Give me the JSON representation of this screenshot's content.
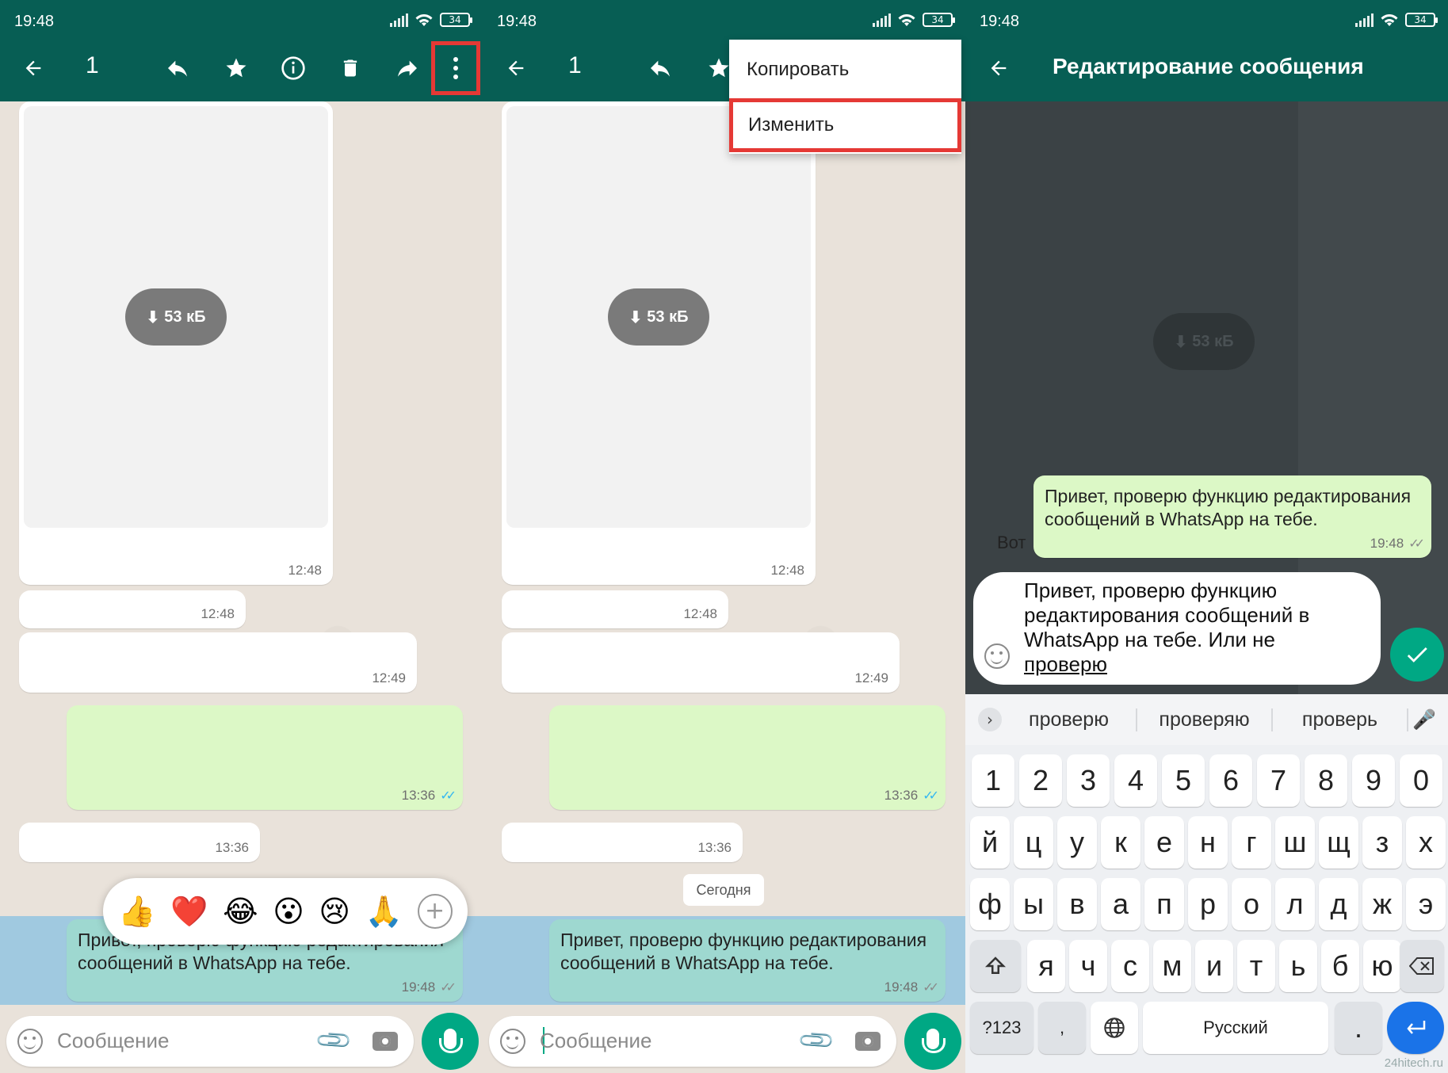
{
  "status": {
    "time": "19:48",
    "battery": "34"
  },
  "panel1": {
    "toolbar": {
      "count": "1",
      "back": "back-arrow",
      "reply": "reply",
      "star": "star",
      "info": "info",
      "delete": "delete",
      "forward": "forward",
      "more": "more"
    },
    "messages": [
      {
        "time": "12:48",
        "size": "53 кБ"
      },
      {
        "time": "12:48"
      },
      {
        "time": "12:49"
      },
      {
        "time": "13:36"
      },
      {
        "time": "13:36"
      }
    ],
    "reactions": [
      "👍",
      "❤️",
      "😂",
      "😮",
      "😢",
      "🙏"
    ],
    "selected_message": {
      "text_visible_tail": "Прив",
      "text": "Привет, проверю функцию редактирования сообщений в WhatsApp на тебе.",
      "time": "19:48"
    },
    "input": {
      "placeholder": "Сообщение"
    }
  },
  "panel2": {
    "toolbar": {
      "count": "1"
    },
    "menu": {
      "copy": "Копировать",
      "edit": "Изменить"
    },
    "messages": [
      {
        "time": "12:48",
        "size": "53 кБ"
      },
      {
        "time": "12:48"
      },
      {
        "time": "12:49"
      },
      {
        "time": "13:36"
      },
      {
        "time": "13:36"
      }
    ],
    "date_chip": "Сегодня",
    "selected_message": {
      "text": "Привет, проверю функцию редактирования сообщений в WhatsApp на тебе.",
      "time": "19:48"
    },
    "input": {
      "placeholder": "Сообщение"
    }
  },
  "panel3": {
    "title": "Редактирование сообщения",
    "size": "53 кБ",
    "left_peek": "Вот",
    "original": {
      "text": "Привет, проверю функцию редактирования сообщений в WhatsApp на тебе.",
      "time": "19:48"
    },
    "edit": {
      "line1": "Привет, проверю функцию",
      "line2": "редактирования сообщений в",
      "line3": "WhatsApp на тебе. Или не",
      "line4": "проверю"
    },
    "keyboard": {
      "suggestions": [
        "проверю",
        "проверяю",
        "проверь"
      ],
      "row_numbers": [
        "1",
        "2",
        "3",
        "4",
        "5",
        "6",
        "7",
        "8",
        "9",
        "0"
      ],
      "row1": [
        "й",
        "ц",
        "у",
        "к",
        "е",
        "н",
        "г",
        "ш",
        "щ",
        "з",
        "х"
      ],
      "row2": [
        "ф",
        "ы",
        "в",
        "а",
        "п",
        "р",
        "о",
        "л",
        "д",
        "ж",
        "э"
      ],
      "row3": [
        "я",
        "ч",
        "с",
        "м",
        "и",
        "т",
        "ь",
        "б",
        "ю"
      ],
      "sym": "?123",
      "comma": ",",
      "space": "Русский",
      "period": "."
    },
    "watermark": "24hitech.ru"
  },
  "colors": {
    "appbar": "#075e54",
    "accent": "#00a884",
    "out_bubble": "#dcf8c6",
    "highlight": "#e53935",
    "selection": "#64b4e6"
  }
}
